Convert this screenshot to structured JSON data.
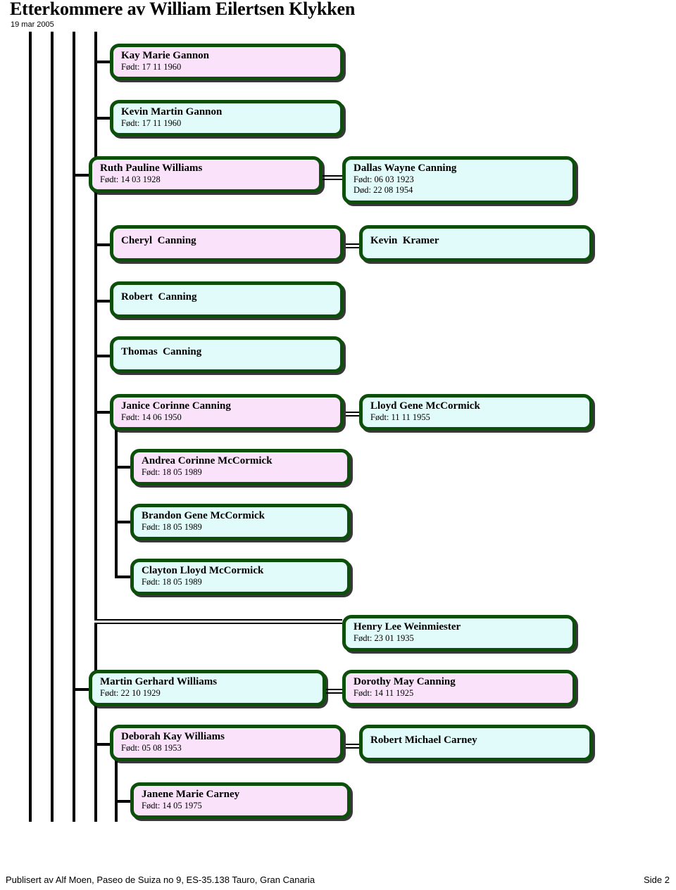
{
  "header": {
    "title": "Etterkommere av William Eilertsen Klykken",
    "date": "19 mar 2005"
  },
  "footer": {
    "publisher": "Publisert av Alf Moen, Paseo de Suiza no 9, ES-35.138 Tauro, Gran Canaria",
    "page": "Side 2"
  },
  "colors": {
    "female_fill": "#fbe2fb",
    "male_fill": "#e0fbf9",
    "box_border": "#0b4f0b",
    "line": "#000000",
    "background": "#ffffff"
  },
  "labels": {
    "born_prefix": "Født:",
    "died_prefix": "Død:"
  },
  "people": [
    {
      "id": "kay-marie-gannon",
      "name": "Kay Marie Gannon",
      "sex": "female",
      "born": "Født: 17 11 1960",
      "died": ""
    },
    {
      "id": "kevin-martin-gannon",
      "name": "Kevin Martin Gannon",
      "sex": "male",
      "born": "Født: 17 11 1960",
      "died": ""
    },
    {
      "id": "ruth-pauline-williams",
      "name": "Ruth Pauline Williams",
      "sex": "female",
      "born": "Født: 14 03 1928",
      "died": ""
    },
    {
      "id": "dallas-wayne-canning",
      "name": "Dallas Wayne Canning",
      "sex": "male",
      "born": "Født: 06 03 1923",
      "died": "Død: 22 08 1954"
    },
    {
      "id": "cheryl-canning",
      "name": "Cheryl  Canning",
      "sex": "female",
      "born": "",
      "died": ""
    },
    {
      "id": "kevin-kramer",
      "name": "Kevin  Kramer",
      "sex": "male",
      "born": "",
      "died": ""
    },
    {
      "id": "robert-canning",
      "name": "Robert  Canning",
      "sex": "male",
      "born": "",
      "died": ""
    },
    {
      "id": "thomas-canning",
      "name": "Thomas  Canning",
      "sex": "male",
      "born": "",
      "died": ""
    },
    {
      "id": "janice-corinne-canning",
      "name": "Janice Corinne Canning",
      "sex": "female",
      "born": "Født: 14 06 1950",
      "died": ""
    },
    {
      "id": "lloyd-gene-mccormick",
      "name": "Lloyd Gene McCormick",
      "sex": "male",
      "born": "Født: 11 11 1955",
      "died": ""
    },
    {
      "id": "andrea-corinne-mccormick",
      "name": "Andrea Corinne McCormick",
      "sex": "female",
      "born": "Født: 18 05 1989",
      "died": ""
    },
    {
      "id": "brandon-gene-mccormick",
      "name": "Brandon Gene McCormick",
      "sex": "male",
      "born": "Født: 18 05 1989",
      "died": ""
    },
    {
      "id": "clayton-lloyd-mccormick",
      "name": "Clayton Lloyd McCormick",
      "sex": "male",
      "born": "Født: 18 05 1989",
      "died": ""
    },
    {
      "id": "henry-lee-weinmiester",
      "name": "Henry Lee Weinmiester",
      "sex": "male",
      "born": "Født: 23 01 1935",
      "died": ""
    },
    {
      "id": "martin-gerhard-williams",
      "name": "Martin Gerhard Williams",
      "sex": "male",
      "born": "Født: 22 10 1929",
      "died": ""
    },
    {
      "id": "dorothy-may-canning",
      "name": "Dorothy May Canning",
      "sex": "female",
      "born": "Født: 14 11 1925",
      "died": ""
    },
    {
      "id": "deborah-kay-williams",
      "name": "Deborah Kay Williams",
      "sex": "female",
      "born": "Født: 05 08 1953",
      "died": ""
    },
    {
      "id": "robert-michael-carney",
      "name": "Robert Michael Carney",
      "sex": "male",
      "born": "",
      "died": ""
    },
    {
      "id": "janene-marie-carney",
      "name": "Janene Marie Carney",
      "sex": "female",
      "born": "Født: 14 05 1975",
      "died": ""
    }
  ]
}
